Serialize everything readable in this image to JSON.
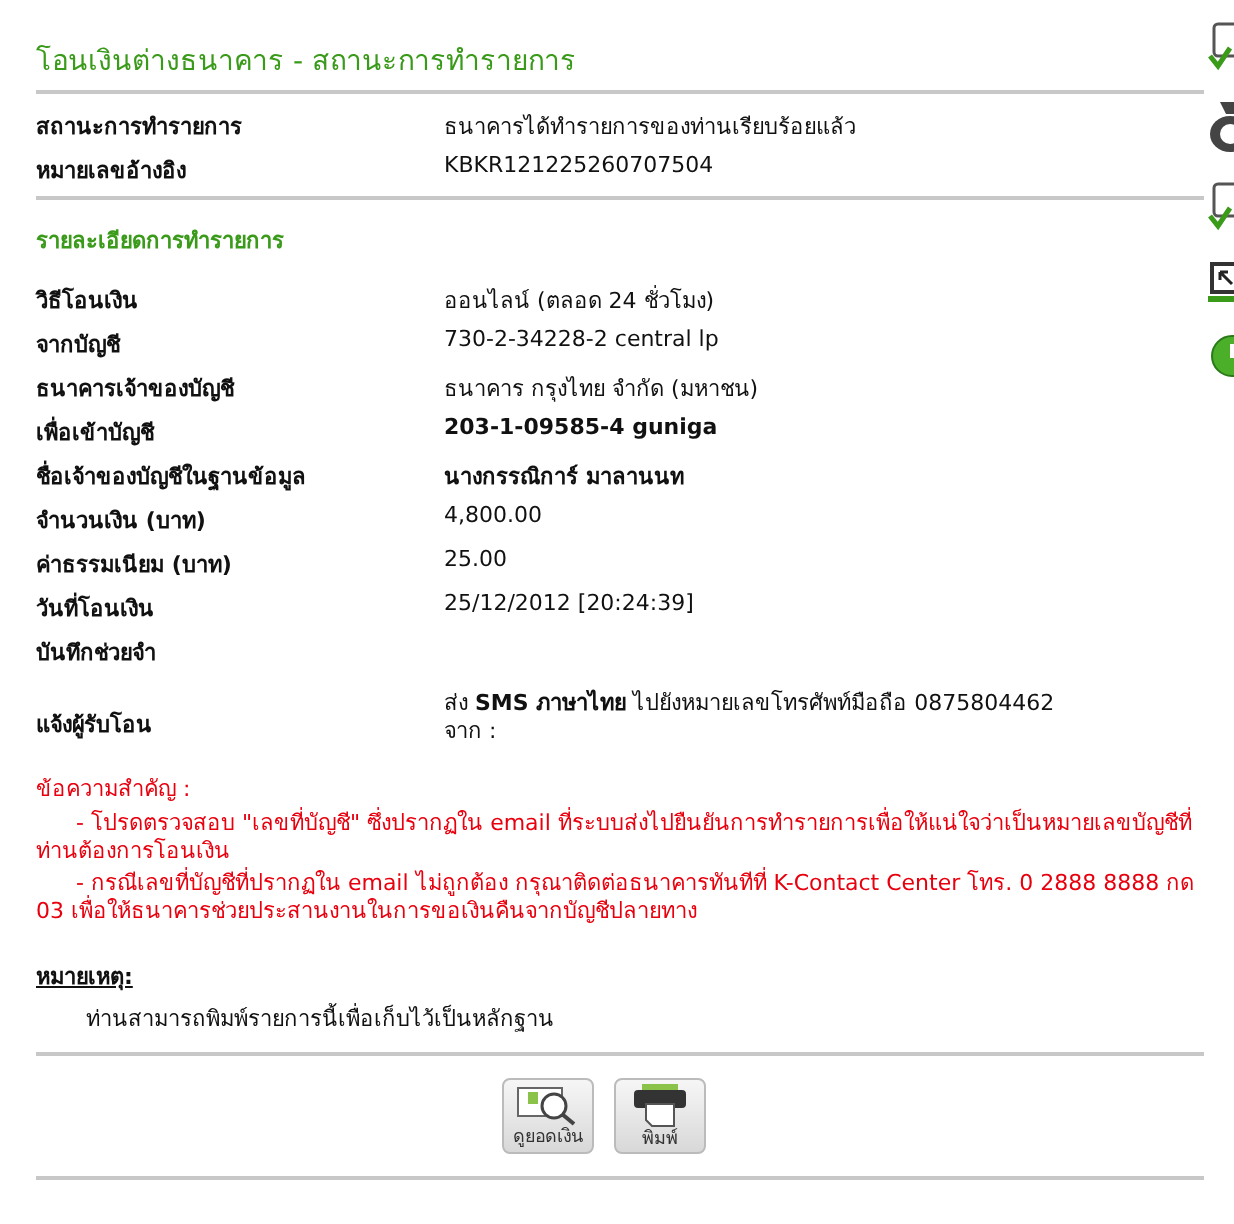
{
  "title": "โอนเงินต่างธนาคาร - สถานะการทำรายการ",
  "summary": [
    {
      "label": "สถานะการทำรายการ",
      "value": "ธนาคารได้ทำรายการของท่านเรียบร้อยแล้ว"
    },
    {
      "label": "หมายเลขอ้างอิง",
      "value": "KBKR121225260707504"
    }
  ],
  "details_title": "รายละเอียดการทำรายการ",
  "details": [
    {
      "label": "วิธีโอนเงิน",
      "value": "ออนไลน์ (ตลอด 24 ชั่วโมง)"
    },
    {
      "label": "จากบัญชี",
      "value": "730-2-34228-2 central lp"
    },
    {
      "label": "ธนาคารเจ้าของบัญชี",
      "value": "ธนาคาร กรุงไทย จำกัด (มหาชน)"
    },
    {
      "label": "เพื่อเข้าบัญชี",
      "value": "203-1-09585-4 guniga",
      "bold": true
    },
    {
      "label": "ชื่อเจ้าของบัญชีในฐานข้อมูล",
      "value": "นางกรรณิการ์ มาลานนท",
      "bold": true
    },
    {
      "label": "จำนวนเงิน (บาท)",
      "value": "4,800.00"
    },
    {
      "label": "ค่าธรรมเนียม (บาท)",
      "value": "25.00"
    },
    {
      "label": "วันที่โอนเงิน",
      "value": "25/12/2012 [20:24:39]"
    },
    {
      "label": "บันทึกช่วยจำ"
    }
  ],
  "notify": {
    "label": "แจ้งผู้รับโอน",
    "lines": [
      "ส่ง **SMS ภาษาไทย** ไปยังหมายเลขโทรศัพท์มือถือ 0875804462",
      "จาก :"
    ]
  },
  "important": {
    "heading": "ข้อความสำคัญ :",
    "items": [
      "- โปรดตรวจสอบ \"เลขที่บัญชี\" ซึ่งปรากฏใน email ที่ระบบส่งไปยืนยันการทำรายการเพื่อให้แน่ใจว่าเป็นหมายเลขบัญชีที่ท่านต้องการโอนเงิน",
      "- กรณีเลขที่บัญชีที่ปรากฏใน email ไม่ถูกต้อง กรุณาติดต่อธนาคารทันทีที่ K-Contact Center โทร. 0 2888 8888 กด 03 เพื่อให้ธนาคารช่วยประสานงานในการขอเงินคืนจากบัญชีปลายทาง"
    ]
  },
  "note": {
    "heading": "หมายเหตุ:",
    "text": "ท่านสามารถพิมพ์รายการนี้เพื่อเก็บไว้เป็นหลักฐาน"
  },
  "buttons": [
    {
      "kind": "balance",
      "label": "ดูยอดเงิน"
    },
    {
      "kind": "print",
      "label": "พิมพ์"
    }
  ]
}
